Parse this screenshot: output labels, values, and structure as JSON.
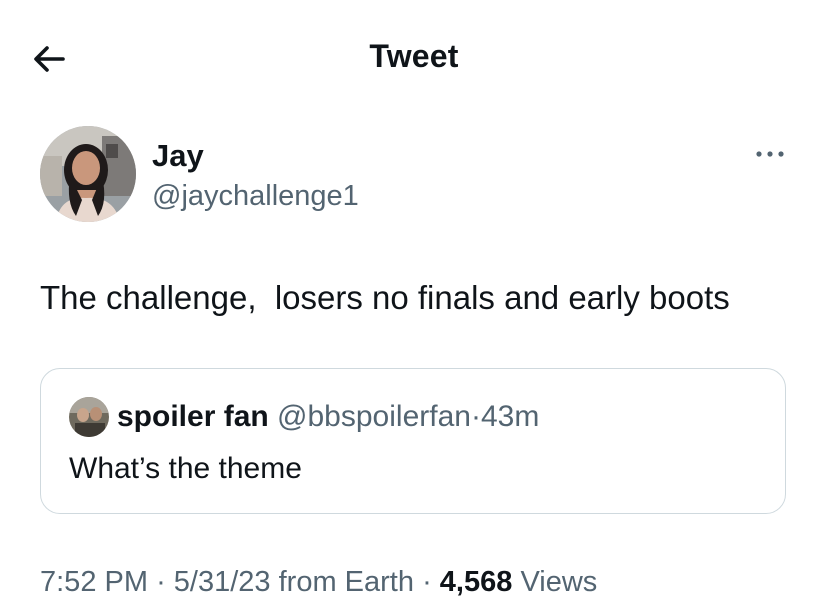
{
  "header": {
    "title": "Tweet",
    "back_icon": "arrow-left-icon"
  },
  "tweet": {
    "author_name": "Jay",
    "author_handle": "@jaychallenge1",
    "more_icon": "more-options-icon",
    "text": "The challenge,  losers no finals and early boots",
    "quote": {
      "author_name": "spoiler fan",
      "author_handle": "@bbspoilerfan",
      "separator": "·",
      "time_ago": "43m",
      "text": "What’s the theme"
    },
    "footer": {
      "time": "7:52 PM",
      "separator": "·",
      "date": "5/31/23",
      "source": "from Earth",
      "views_count": "4,568",
      "views_label": "Views"
    }
  },
  "colors": {
    "text": "#0f1419",
    "secondary": "#536471",
    "border": "#cfd9de"
  }
}
